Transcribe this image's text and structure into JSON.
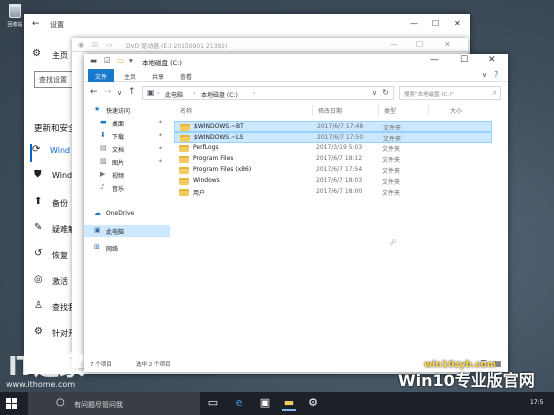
{
  "desktop": {
    "icon_label": "回收站"
  },
  "settings": {
    "title": "设置",
    "home_label": "主页",
    "search_placeholder": "查找设置",
    "section_title": "更新和安全",
    "nav": [
      {
        "icon": "sync-icon",
        "label": "Wind"
      },
      {
        "icon": "shield-icon",
        "label": "Wind"
      },
      {
        "icon": "backup-icon",
        "label": "备份"
      },
      {
        "icon": "wrench-icon",
        "label": "疑难解"
      },
      {
        "icon": "history-icon",
        "label": "恢复"
      },
      {
        "icon": "check-circle-icon",
        "label": "激活"
      },
      {
        "icon": "person-icon",
        "label": "查找我"
      },
      {
        "icon": "dev-icon",
        "label": "针对开"
      }
    ]
  },
  "dvd_window": {
    "title": "DVD 驱动器 (E:) 20150901 21392)"
  },
  "explorer": {
    "title": "本地磁盘 (C:)",
    "tabs": [
      "文件",
      "主页",
      "共享",
      "查看"
    ],
    "address": [
      "此电脑",
      "本地磁盘 (C:)"
    ],
    "search_placeholder": "搜索\"本地磁盘 (C:)\"",
    "columns": {
      "name": "名称",
      "date": "修改日期",
      "type": "类型",
      "size": "大小"
    },
    "nav": [
      {
        "icon": "star-icon",
        "label": "快速访问",
        "pinned": false,
        "indent": 0
      },
      {
        "icon": "desktop-icon",
        "label": "桌面",
        "pinned": true,
        "indent": 1
      },
      {
        "icon": "download-icon",
        "label": "下载",
        "pinned": true,
        "indent": 1
      },
      {
        "icon": "document-icon",
        "label": "文档",
        "pinned": true,
        "indent": 1
      },
      {
        "icon": "picture-icon",
        "label": "图片",
        "pinned": true,
        "indent": 1
      },
      {
        "icon": "video-icon",
        "label": "视频",
        "pinned": false,
        "indent": 1
      },
      {
        "icon": "music-icon",
        "label": "音乐",
        "pinned": false,
        "indent": 1
      },
      {
        "icon": "cloud-icon",
        "label": "OneDrive",
        "pinned": false,
        "indent": 0
      },
      {
        "icon": "computer-icon",
        "label": "此电脑",
        "pinned": false,
        "indent": 0
      },
      {
        "icon": "network-icon",
        "label": "网络",
        "pinned": false,
        "indent": 0
      }
    ],
    "files": [
      {
        "name": "$WINDOWS.~BT",
        "date": "2017/6/7 17:48",
        "type": "文件夹",
        "selected": true
      },
      {
        "name": "$WINDOWS.~LS",
        "date": "2017/6/7 17:50",
        "type": "文件夹",
        "selected": true
      },
      {
        "name": "PerfLogs",
        "date": "2017/3/19 5:03",
        "type": "文件夹",
        "selected": false
      },
      {
        "name": "Program Files",
        "date": "2017/6/7 18:12",
        "type": "文件夹",
        "selected": false
      },
      {
        "name": "Program Files (x86)",
        "date": "2017/6/7 17:54",
        "type": "文件夹",
        "selected": false
      },
      {
        "name": "Windows",
        "date": "2017/6/7 18:03",
        "type": "文件夹",
        "selected": false
      },
      {
        "name": "用户",
        "date": "2017/6/7 18:00",
        "type": "文件夹",
        "selected": false
      }
    ],
    "status_count": "7 个项目",
    "status_selected": "选中 2 个项目"
  },
  "watermarks": {
    "logo": "IT之家",
    "url": "www.ithome.com",
    "brand": "Win10专业版官网",
    "site": "win10zyb.com"
  },
  "taskbar": {
    "search_text": "有问题尽管问我",
    "icons": [
      "task-view-icon",
      "edge-icon",
      "store-icon",
      "explorer-icon",
      "settings-icon"
    ],
    "clock": "17:5"
  },
  "colors": {
    "accent": "#1979ca",
    "selection": "#cce8ff",
    "folder": "#f3cb61",
    "taskbar": "#1d2027"
  }
}
